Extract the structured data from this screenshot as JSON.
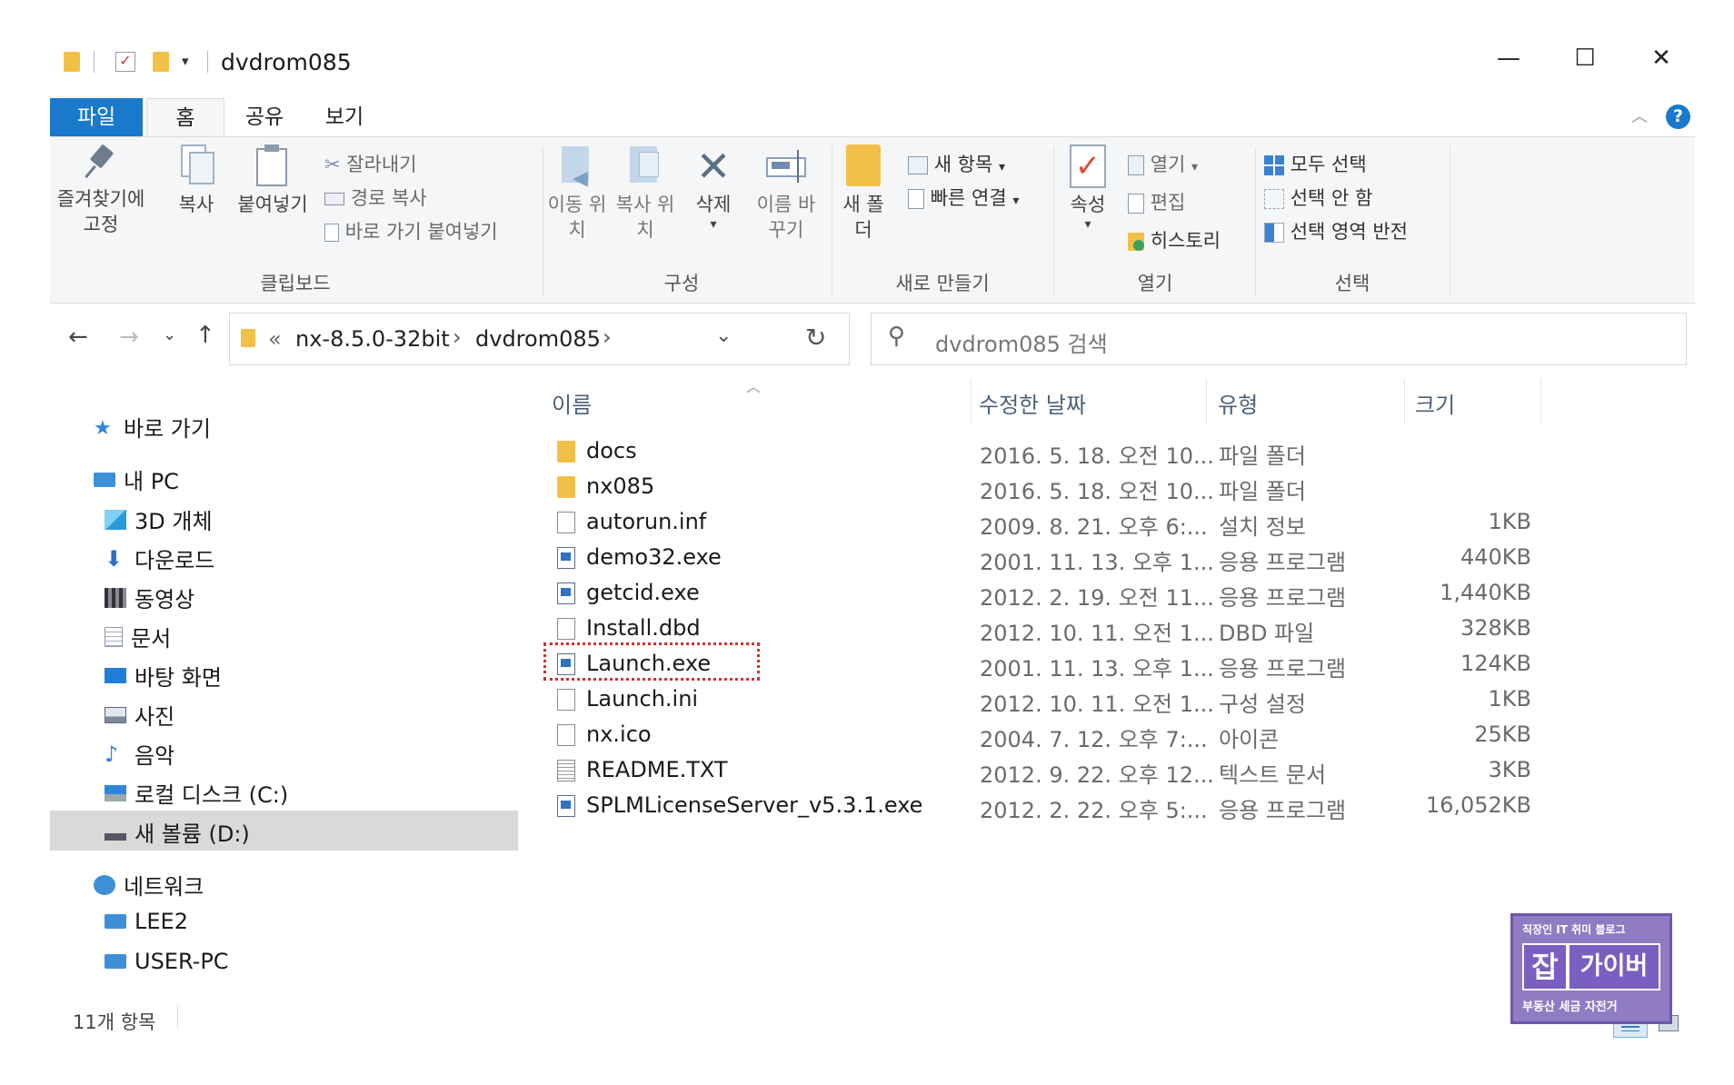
{
  "window": {
    "title": "dvdrom085",
    "minimize": "—",
    "maximize": "☐",
    "close": "✕"
  },
  "tabs": [
    "파일",
    "홈",
    "공유",
    "보기"
  ],
  "ribbon": {
    "clipboard": {
      "pin": "즐겨찾기에 고정",
      "copy": "복사",
      "paste": "붙여넣기",
      "cut": "잘라내기",
      "copy_path": "경로 복사",
      "paste_shortcut": "바로 가기 붙여넣기",
      "group_label": "클립보드"
    },
    "organize": {
      "move_to": "이동 위치",
      "copy_to": "복사 위치",
      "delete": "삭제",
      "rename": "이름 바꾸기",
      "group_label": "구성"
    },
    "new": {
      "new_folder": "새 폴더",
      "new_item": "새 항목",
      "easy_access": "빠른 연결",
      "group_label": "새로 만들기"
    },
    "open": {
      "properties": "속성",
      "open": "열기",
      "edit": "편집",
      "history": "히스토리",
      "group_label": "열기"
    },
    "select": {
      "select_all": "모두 선택",
      "select_none": "선택 안 함",
      "invert": "선택 영역 반전",
      "group_label": "선택"
    }
  },
  "address": {
    "crumb_prefix": "«",
    "crumbs": [
      "nx-8.5.0-32bit",
      "dvdrom085"
    ],
    "search_placeholder": "dvdrom085 검색"
  },
  "nav": {
    "quick_access": "바로 가기",
    "this_pc": "내 PC",
    "items": [
      "3D 개체",
      "다운로드",
      "동영상",
      "문서",
      "바탕 화면",
      "사진",
      "음악",
      "로컬 디스크 (C:)",
      "새 볼륨 (D:)"
    ],
    "network": "네트워크",
    "network_items": [
      "LEE2",
      "USER-PC"
    ]
  },
  "columns": {
    "name": "이름",
    "date": "수정한 날짜",
    "type": "유형",
    "size": "크기"
  },
  "files": [
    {
      "name": "docs",
      "date": "2016. 5. 18. 오전 10...",
      "type": "파일 폴더",
      "size": "",
      "icon": "folder-icon"
    },
    {
      "name": "nx085",
      "date": "2016. 5. 18. 오전 10...",
      "type": "파일 폴더",
      "size": "",
      "icon": "folder-icon"
    },
    {
      "name": "autorun.inf",
      "date": "2009. 8. 21. 오후 6:...",
      "type": "설치 정보",
      "size": "1KB",
      "icon": "file-icon"
    },
    {
      "name": "demo32.exe",
      "date": "2001. 11. 13. 오후 1...",
      "type": "응용 프로그램",
      "size": "440KB",
      "icon": "exe-icon"
    },
    {
      "name": "getcid.exe",
      "date": "2012. 2. 19. 오전 11...",
      "type": "응용 프로그램",
      "size": "1,440KB",
      "icon": "exe-icon"
    },
    {
      "name": "Install.dbd",
      "date": "2012. 10. 11. 오전 1...",
      "type": "DBD 파일",
      "size": "328KB",
      "icon": "file-icon"
    },
    {
      "name": "Launch.exe",
      "date": "2001. 11. 13. 오후 1...",
      "type": "응용 프로그램",
      "size": "124KB",
      "icon": "exe-icon"
    },
    {
      "name": "Launch.ini",
      "date": "2012. 10. 11. 오전 1...",
      "type": "구성 설정",
      "size": "1KB",
      "icon": "file-icon"
    },
    {
      "name": "nx.ico",
      "date": "2004. 7. 12. 오후 7:...",
      "type": "아이콘",
      "size": "25KB",
      "icon": "file-icon"
    },
    {
      "name": "README.TXT",
      "date": "2012. 9. 22. 오후 12...",
      "type": "텍스트 문서",
      "size": "3KB",
      "icon": "text-file-icon"
    },
    {
      "name": "SPLMLicenseServer_v5.3.1.exe",
      "date": "2012. 2. 22. 오후 5:...",
      "type": "응용 프로그램",
      "size": "16,052KB",
      "icon": "exe-icon"
    }
  ],
  "status": {
    "count": "11개 항목"
  },
  "watermark": {
    "top": "직장인 IT 취미 블로그",
    "main_a": "잡",
    "main_b": "가이버",
    "bottom": "부동산 세금 자전거"
  },
  "colors": {
    "accent": "#1979ca",
    "selected_nav": "#d9d9d9",
    "highlight_box": "#d32f2f"
  }
}
